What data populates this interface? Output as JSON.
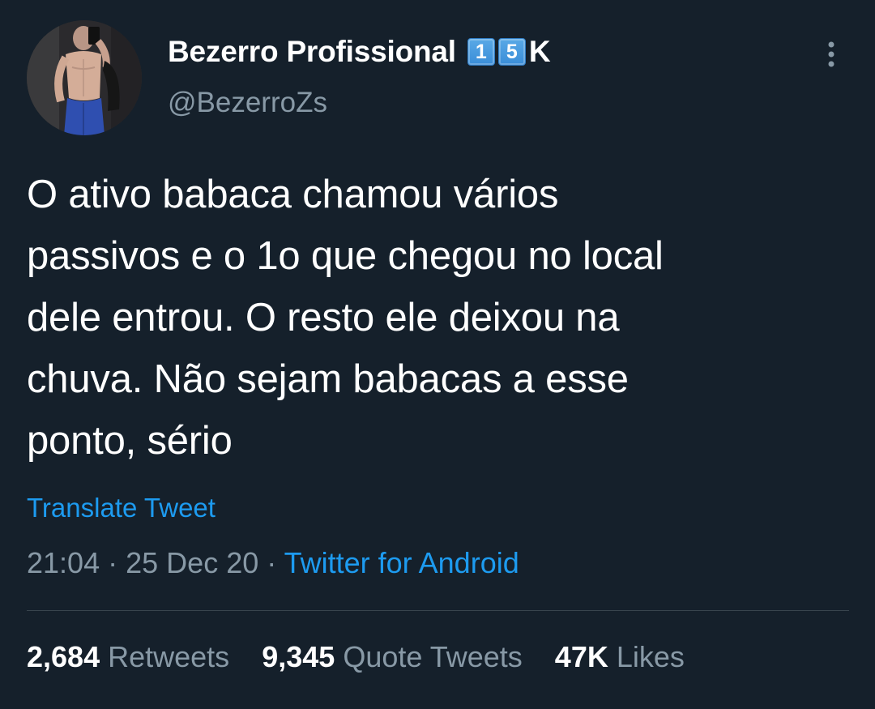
{
  "author": {
    "display_name": "Bezerro Profissional",
    "badge_digits": [
      "1",
      "5"
    ],
    "badge_suffix": "K",
    "handle": "@BezerroZs",
    "avatar_icon": "profile-photo"
  },
  "menu": {
    "icon": "more-vertical-icon"
  },
  "tweet": {
    "lines": [
      "O ativo babaca chamou vários",
      "passivos e o 1o que chegou no local",
      "dele entrou. O resto ele deixou na",
      "chuva. Não sejam babacas a esse",
      "ponto, sério"
    ],
    "translate_label": "Translate Tweet",
    "time": "21:04",
    "date": "25 Dec 20",
    "separator": "·",
    "source": "Twitter for Android"
  },
  "stats": {
    "retweets_count": "2,684",
    "retweets_label": "Retweets",
    "quotes_count": "9,345",
    "quotes_label": "Quote Tweets",
    "likes_count": "47K",
    "likes_label": "Likes"
  },
  "colors": {
    "background": "#15202b",
    "primary_text": "#ffffff",
    "secondary_text": "#8899a6",
    "link": "#1d9bf0",
    "divider": "#38444d"
  }
}
